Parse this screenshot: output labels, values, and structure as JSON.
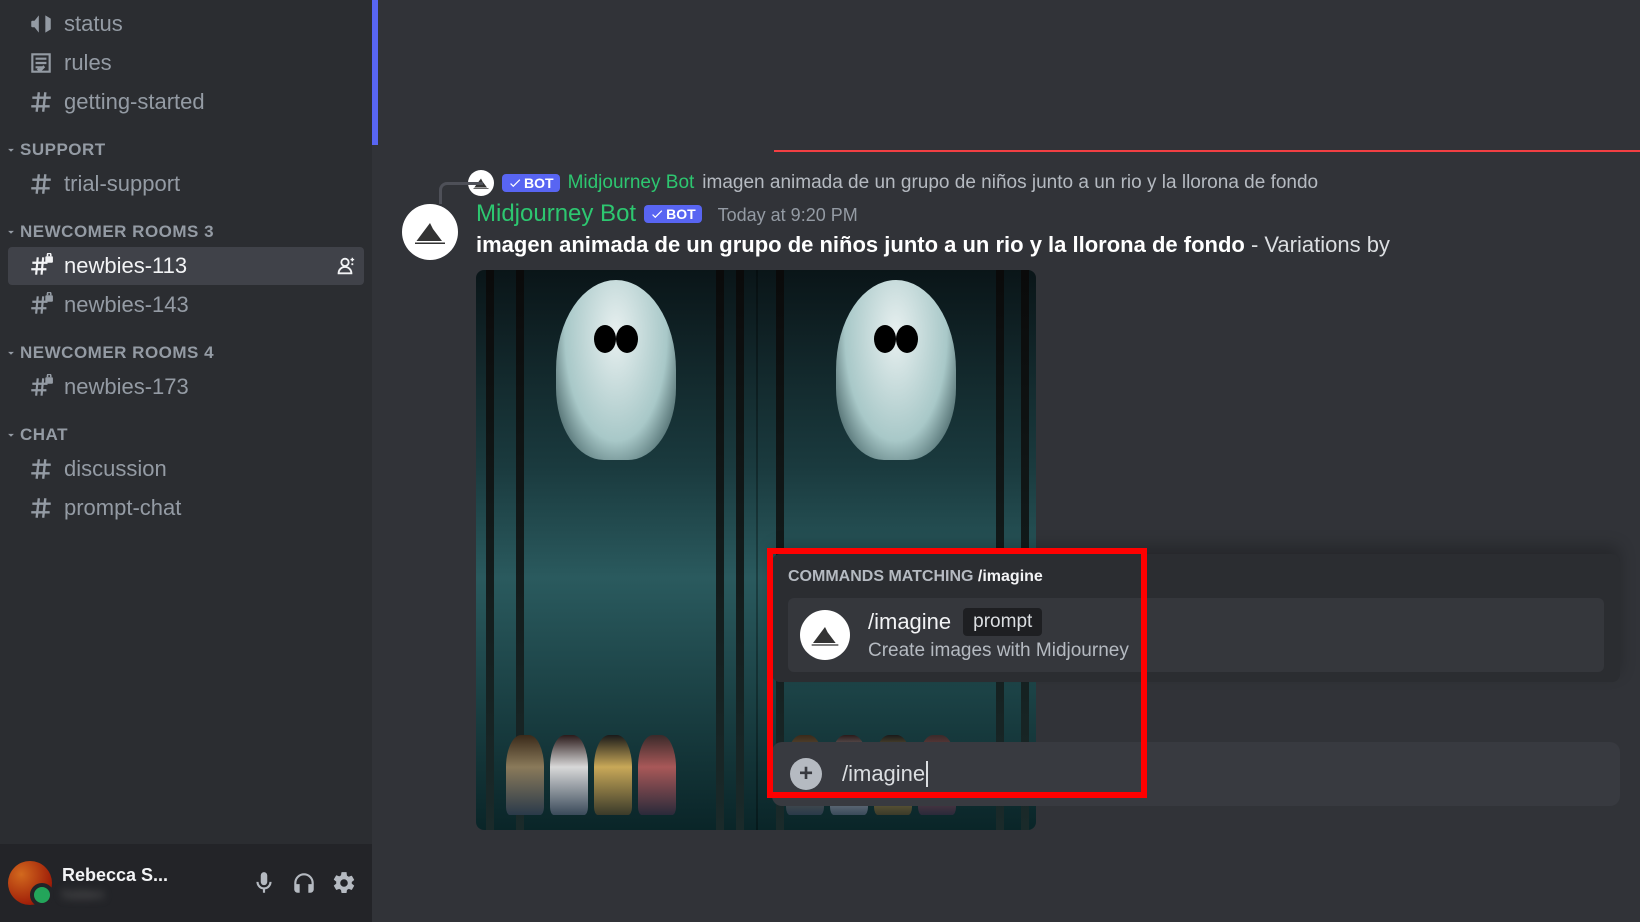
{
  "sidebar": {
    "top_channels": [
      {
        "icon": "megaphone",
        "label": "status"
      },
      {
        "icon": "rules",
        "label": "rules"
      },
      {
        "icon": "hash",
        "label": "getting-started"
      }
    ],
    "groups": [
      {
        "name": "SUPPORT",
        "channels": [
          {
            "icon": "hash",
            "label": "trial-support",
            "active": false
          }
        ]
      },
      {
        "name": "NEWCOMER ROOMS 3",
        "channels": [
          {
            "icon": "hash-lock",
            "label": "newbies-113",
            "active": true,
            "adduser": true
          },
          {
            "icon": "hash-lock",
            "label": "newbies-143",
            "active": false
          }
        ]
      },
      {
        "name": "NEWCOMER ROOMS 4",
        "channels": [
          {
            "icon": "hash-lock",
            "label": "newbies-173",
            "active": false
          }
        ]
      },
      {
        "name": "CHAT",
        "channels": [
          {
            "icon": "hash",
            "label": "discussion",
            "active": false
          },
          {
            "icon": "hash",
            "label": "prompt-chat",
            "active": false
          }
        ]
      }
    ]
  },
  "user": {
    "name": "Rebecca S...",
    "sub": "hidden"
  },
  "message": {
    "reply": {
      "bot": "BOT",
      "name": "Midjourney Bot",
      "text": "imagen animada de un grupo de niños junto a un rio y la llorona de fondo"
    },
    "name": "Midjourney Bot",
    "bot": "BOT",
    "time": "Today at 9:20 PM",
    "prompt": "imagen animada de un grupo de niños junto a un rio y la llorona de fondo",
    "suffix": " - Variations by"
  },
  "command_popup": {
    "header_prefix": "COMMANDS MATCHING ",
    "header_match": "/imagine",
    "item": {
      "name": "/imagine",
      "param": "prompt",
      "desc": "Create images with Midjourney"
    }
  },
  "input": {
    "typed": "/imagine"
  }
}
